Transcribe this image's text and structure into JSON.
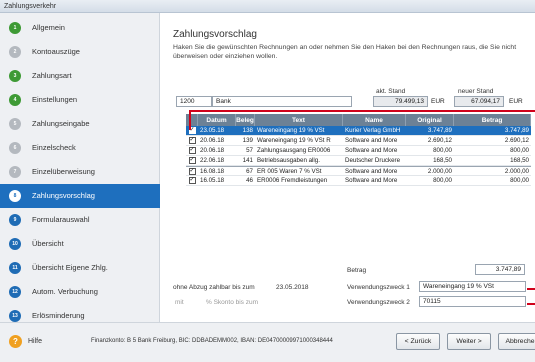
{
  "window": {
    "title": "Zahlungsverkehr"
  },
  "steps": [
    {
      "num": "1",
      "label": "Allgemein",
      "state": "green"
    },
    {
      "num": "2",
      "label": "Kontoauszüge",
      "state": "gray"
    },
    {
      "num": "3",
      "label": "Zahlungsart",
      "state": "green"
    },
    {
      "num": "4",
      "label": "Einstellungen",
      "state": "green"
    },
    {
      "num": "5",
      "label": "Zahlungseingabe",
      "state": "gray"
    },
    {
      "num": "6",
      "label": "Einzelscheck",
      "state": "gray"
    },
    {
      "num": "7",
      "label": "Einzelüberweisung",
      "state": "gray"
    },
    {
      "num": "8",
      "label": "Zahlungsvorschlag",
      "state": "active"
    },
    {
      "num": "9",
      "label": "Formularauswahl",
      "state": "blue"
    },
    {
      "num": "10",
      "label": "Übersicht",
      "state": "blue"
    },
    {
      "num": "11",
      "label": "Übersicht Eigene Zhlg.",
      "state": "blue"
    },
    {
      "num": "12",
      "label": "Autom. Verbuchung",
      "state": "blue"
    },
    {
      "num": "13",
      "label": "Erlösminderung",
      "state": "blue"
    }
  ],
  "main": {
    "title": "Zahlungsvorschlag",
    "instructions": "Haken Sie die gewünschten Rechnungen an oder nehmen Sie den Haken bei den Rechnungen raus, die Sie nicht überweisen oder einziehen wollen.",
    "akt_stand_label": "akt. Stand",
    "neuer_stand_label": "neuer Stand",
    "account_number": "1200",
    "account_name": "Bank",
    "akt_stand_value": "79.499,13",
    "neuer_stand_value": "67.094,17",
    "currency": "EUR"
  },
  "table": {
    "headers": [
      "",
      "Datum",
      "Beleg",
      "Text",
      "Name",
      "Original",
      "Betrag"
    ],
    "rows": [
      {
        "checked": true,
        "date": "23.05.18",
        "beleg": "138",
        "text": "Wareneingang 19 % VSt",
        "name": "Kurier Verlag GmbH",
        "original": "3.747,89",
        "betrag": "3.747,89",
        "selected": true
      },
      {
        "checked": true,
        "date": "20.06.18",
        "beleg": "139",
        "text": "Wareneingang 19 % VSt R",
        "name": "Software and More",
        "original": "2.690,12",
        "betrag": "2.690,12",
        "selected": false
      },
      {
        "checked": true,
        "date": "20.06.18",
        "beleg": "57",
        "text": "Zahlungsausgang ER0006",
        "name": "Software and More",
        "original": "800,00",
        "betrag": "800,00",
        "selected": false
      },
      {
        "checked": true,
        "date": "22.06.18",
        "beleg": "141",
        "text": "Betriebsausgaben allg.",
        "name": "Deutscher Druckere",
        "original": "168,50",
        "betrag": "168,50",
        "selected": false
      },
      {
        "checked": true,
        "date": "16.08.18",
        "beleg": "67",
        "text": "ER 005 Waren 7 % VSt",
        "name": "Software and More",
        "original": "2.000,00",
        "betrag": "2.000,00",
        "selected": false
      },
      {
        "checked": true,
        "date": "16.05.18",
        "beleg": "46",
        "text": "ER0006 Fremdleistungen",
        "name": "Software and More",
        "original": "800,00",
        "betrag": "800,00",
        "selected": false
      }
    ]
  },
  "bottom": {
    "betrag_label": "Betrag",
    "betrag_value": "3.747,89",
    "ohne_abzug_label": "ohne Abzug zahlbar bis zum",
    "ohne_abzug_date": "23.05.2018",
    "mit_label": "mit",
    "skonto_label": "% Skonto bis zum",
    "vz1_label": "Verwendungszweck 1",
    "vz1_value": "Wareneingang 19 % VSt",
    "vz2_label": "Verwendungszweck 2",
    "vz2_value": "70115"
  },
  "footer": {
    "help_label": "Hilfe",
    "fininfo": "Finanzkonto: B  5 Bank Freiburg, BIC: DDBADEMM002, IBAN: DE04700009971000348444",
    "back_label": "< Zurück",
    "next_label": "Weiter >",
    "cancel_label": "Abbreche"
  }
}
